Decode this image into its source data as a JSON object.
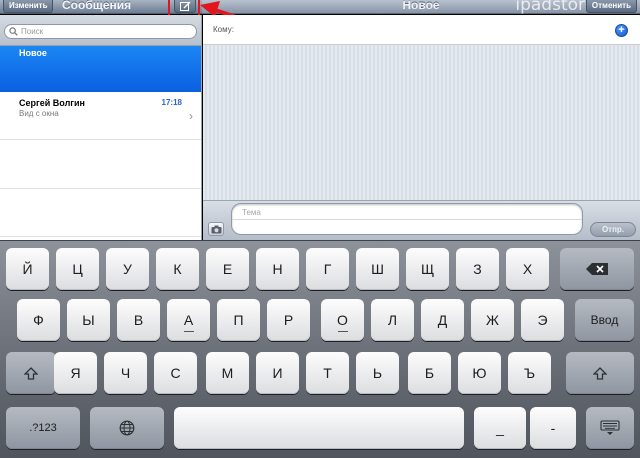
{
  "left_header": {
    "edit_label": "Изменить",
    "title": "Сообщения"
  },
  "right_header": {
    "title": "Новое",
    "cancel_label": "Отменить",
    "watermark": "ipadstor"
  },
  "search": {
    "placeholder": "Поиск"
  },
  "conversations": [
    {
      "title": "Новое",
      "selected": true
    },
    {
      "name": "Сергей Волгин",
      "time": "17:18",
      "preview": "Вид с окна"
    }
  ],
  "compose": {
    "to_label": "Кому:",
    "subject_placeholder": "Тема",
    "send_label": "Отпр."
  },
  "keyboard": {
    "row1": [
      "Й",
      "Ц",
      "У",
      "К",
      "Е",
      "Н",
      "Г",
      "Ш",
      "Щ",
      "З",
      "Х"
    ],
    "row2": [
      "Ф",
      "Ы",
      "В",
      "А",
      "П",
      "Р",
      "О",
      "Л",
      "Д",
      "Ж",
      "Э"
    ],
    "enter_label": "Ввод",
    "row3": [
      "Я",
      "Ч",
      "С",
      "М",
      "И",
      "Т",
      "Ь",
      "Б",
      "Ю",
      "Ъ"
    ],
    "numbers_label": ".?123",
    "row4_punct": [
      "_",
      "-"
    ]
  },
  "colors": {
    "highlight": "#e0161c",
    "selection": "#0b5fe0",
    "time": "#2a64c8"
  },
  "icons": {
    "compose": "compose-icon",
    "search": "search-icon",
    "add_contact": "plus-circle-icon",
    "camera": "camera-icon",
    "backspace": "backspace-icon",
    "shift": "shift-icon",
    "globe": "globe-icon",
    "hide_keyboard": "keyboard-hide-icon"
  }
}
